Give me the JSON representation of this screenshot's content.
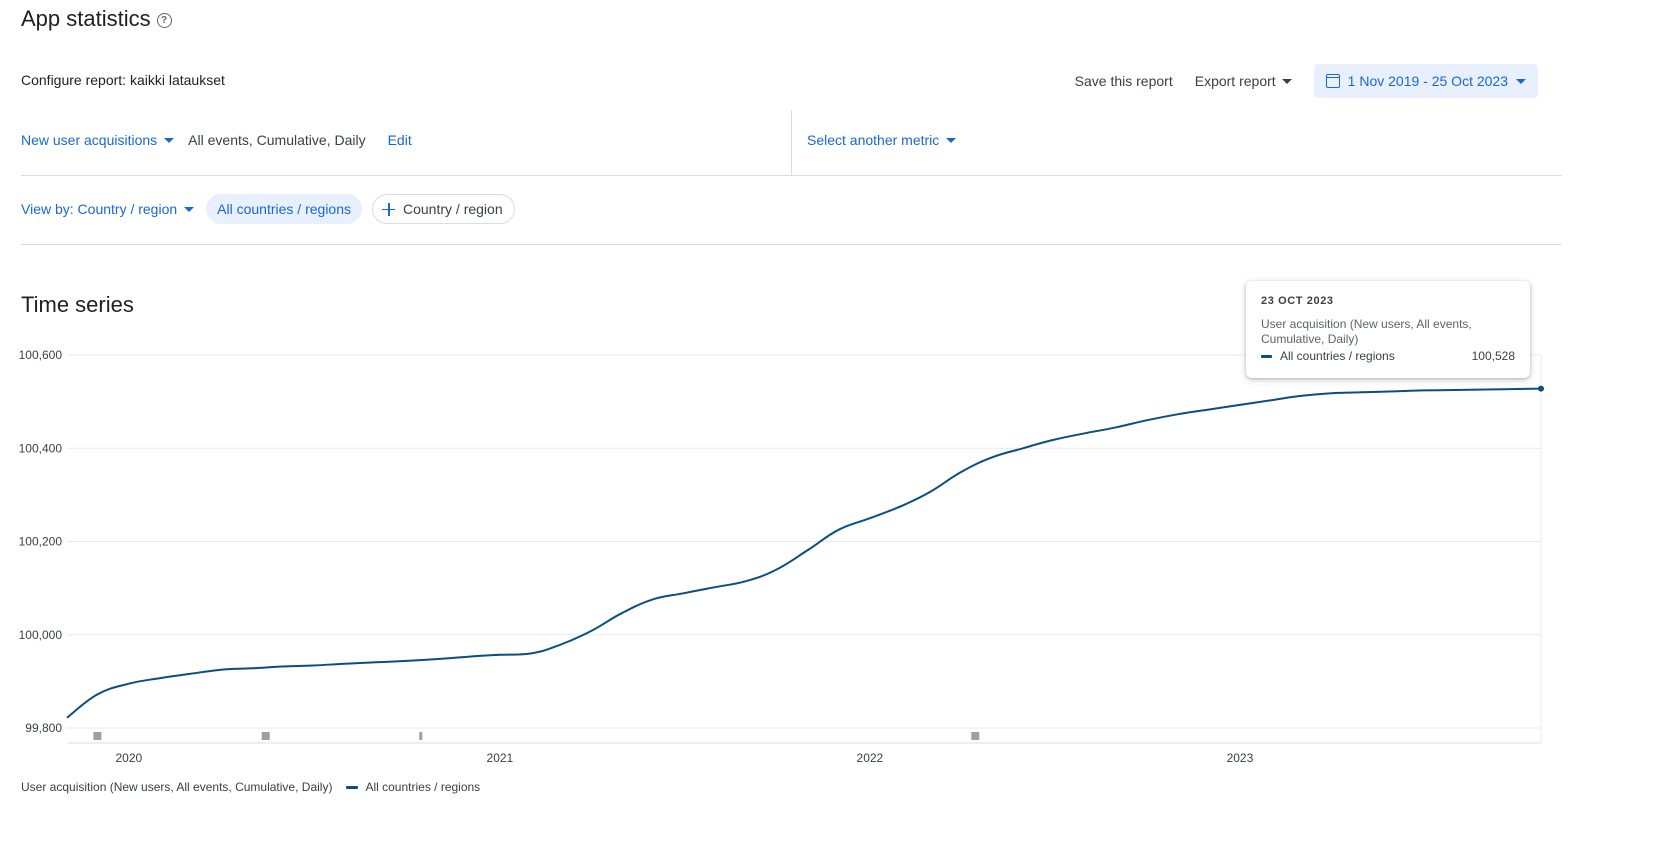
{
  "header": {
    "title": "App statistics",
    "help_icon": "help-circle-icon",
    "config_label": "Configure report: kaikki lataukset"
  },
  "actions": {
    "save_label": "Save this report",
    "export_label": "Export report",
    "date_range": "1 Nov 2019 - 25 Oct 2023"
  },
  "metric": {
    "selector_label": "New user acquisitions",
    "detail": "All events, Cumulative, Daily",
    "edit_label": "Edit",
    "another_metric_label": "Select another metric"
  },
  "view": {
    "view_by_label": "View by: Country / region",
    "active_chip": "All countries / regions",
    "add_chip": "Country / region"
  },
  "section": {
    "title": "Time series"
  },
  "tooltip": {
    "date": "23 OCT 2023",
    "metric": "User acquisition (New users, All events, Cumulative, Daily)",
    "series": "All countries / regions",
    "value": "100,528"
  },
  "legend": {
    "metric": "User acquisition (New users, All events, Cumulative, Daily)",
    "series": "All countries / regions"
  },
  "colors": {
    "accent": "#1967d2",
    "line": "#0b4f7c",
    "chip_bg": "#e8f0fe"
  },
  "chart_data": {
    "type": "line",
    "title": "Time series",
    "xlabel": "",
    "ylabel": "",
    "ylim": [
      99800,
      100600
    ],
    "xlim": [
      "2019-11-01",
      "2023-10-25"
    ],
    "y_ticks": [
      99800,
      100000,
      100200,
      100400,
      100600
    ],
    "y_tick_labels": [
      "99,800",
      "100,000",
      "100,200",
      "100,400",
      "100,600"
    ],
    "x_tick_labels": [
      "2020",
      "2021",
      "2022",
      "2023"
    ],
    "x_ticks": [
      "2020-01-01",
      "2021-01-01",
      "2022-01-01",
      "2023-01-01"
    ],
    "grid": true,
    "legend_position": "bottom-left",
    "annotation_markers": [
      "2019-12-01",
      "2020-05-15",
      "2020-10-15",
      "2022-04-15"
    ],
    "series": [
      {
        "name": "All countries / regions",
        "x": [
          "2019-11-01",
          "2019-12-01",
          "2020-01-01",
          "2020-02-01",
          "2020-03-01",
          "2020-04-01",
          "2020-05-01",
          "2020-06-01",
          "2020-07-01",
          "2020-08-01",
          "2020-09-01",
          "2020-10-01",
          "2020-11-01",
          "2020-12-01",
          "2021-01-01",
          "2021-02-01",
          "2021-03-01",
          "2021-04-01",
          "2021-05-01",
          "2021-06-01",
          "2021-07-01",
          "2021-08-01",
          "2021-09-01",
          "2021-10-01",
          "2021-11-01",
          "2021-12-01",
          "2022-01-01",
          "2022-02-01",
          "2022-03-01",
          "2022-04-01",
          "2022-05-01",
          "2022-06-01",
          "2022-07-01",
          "2022-08-01",
          "2022-09-01",
          "2022-10-01",
          "2022-11-01",
          "2022-12-01",
          "2023-01-01",
          "2023-02-01",
          "2023-03-01",
          "2023-04-01",
          "2023-05-01",
          "2023-06-01",
          "2023-07-01",
          "2023-08-01",
          "2023-09-01",
          "2023-10-01",
          "2023-10-25"
        ],
        "values": [
          99822,
          99872,
          99895,
          99907,
          99916,
          99925,
          99928,
          99932,
          99934,
          99938,
          99941,
          99944,
          99948,
          99953,
          99957,
          99960,
          99978,
          100008,
          100046,
          100076,
          100089,
          100102,
          100115,
          100140,
          100182,
          100225,
          100250,
          100276,
          100306,
          100349,
          100380,
          100400,
          100418,
          100432,
          100445,
          100460,
          100473,
          100483,
          100493,
          100503,
          100512,
          100518,
          100520,
          100522,
          100524,
          100525,
          100526,
          100527,
          100528
        ]
      }
    ]
  }
}
